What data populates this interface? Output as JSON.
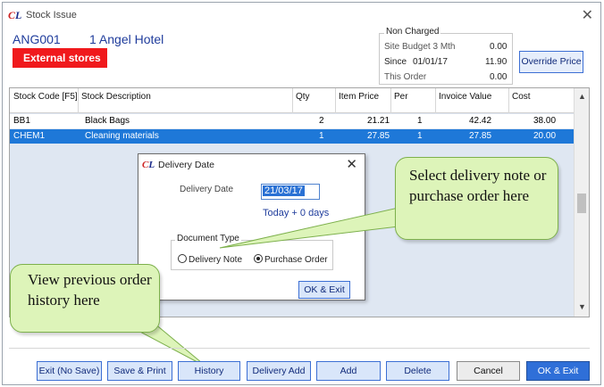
{
  "window": {
    "logo": "CL",
    "title": "Stock Issue"
  },
  "account": {
    "code": "ANG001",
    "name": "1 Angel Hotel",
    "badge": "External stores"
  },
  "non_charged": {
    "legend": "Non Charged",
    "site_budget_label": "Site Budget 3 Mth",
    "site_budget_value": "0.00",
    "since_label": "Since",
    "since_date": "01/01/17",
    "since_value": "11.90",
    "this_order_label": "This Order",
    "this_order_value": "0.00"
  },
  "override_price_label": "Override Price",
  "grid": {
    "columns": [
      "Stock Code [F5]",
      "Stock Description",
      "Qty",
      "Item Price",
      "Per",
      "Invoice Value",
      "Cost"
    ],
    "rows": [
      [
        "BB1",
        "Black Bags",
        "2",
        "21.21",
        "1",
        "42.42",
        "38.00"
      ],
      [
        "CHEM1",
        "Cleaning materials",
        "1",
        "27.85",
        "1",
        "27.85",
        "20.00"
      ]
    ],
    "selected_row": 1,
    "scroll_up": "▲",
    "scroll_down": "▼"
  },
  "dialog": {
    "logo": "CL",
    "title": "Delivery Date",
    "date_label": "Delivery Date",
    "date_value": "21/03/17",
    "today_text": "Today +  0 days",
    "doctype_legend": "Document Type",
    "option_delivery_note": "Delivery Note",
    "option_purchase_order": "Purchase Order",
    "selected_option": "Purchase Order",
    "ok_label": "OK & Exit"
  },
  "callouts": {
    "delivery": "Select delivery note or purchase order here",
    "history": "View previous order history here"
  },
  "footer_buttons": [
    "Exit (No Save)",
    "Save & Print",
    "History",
    "Delivery Add",
    "Add",
    "Delete",
    "Cancel",
    "OK & Exit"
  ],
  "colors": {
    "accent_blue": "#1f3c9c",
    "badge_red": "#f0191c",
    "selection": "#1e78d8",
    "callout_fill": "#ddf4b9"
  }
}
